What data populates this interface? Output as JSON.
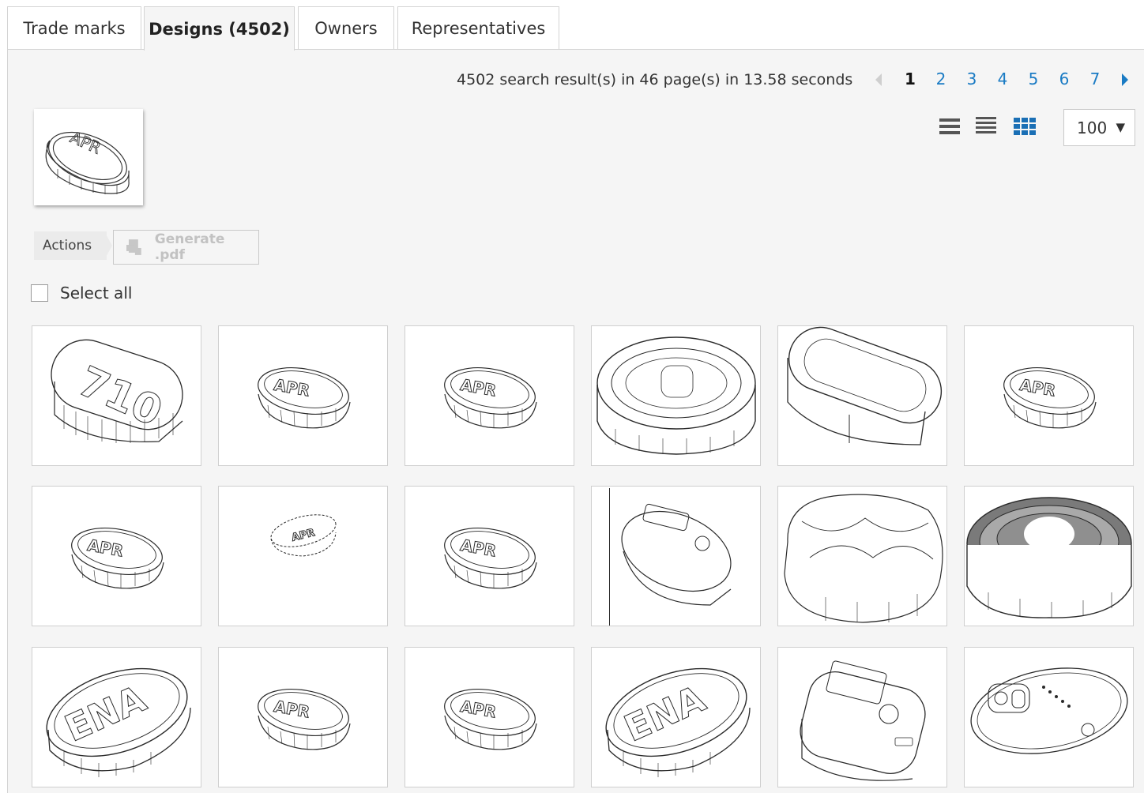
{
  "tabs": [
    {
      "label": "Trade marks",
      "active": false
    },
    {
      "label": "Designs (4502)",
      "active": true
    },
    {
      "label": "Owners",
      "active": false
    },
    {
      "label": "Representatives",
      "active": false
    }
  ],
  "results_summary": "4502 search result(s) in 46 page(s) in 13.58 seconds",
  "pagination": {
    "pages": [
      "1",
      "2",
      "3",
      "4",
      "5",
      "6",
      "7"
    ],
    "current": "1"
  },
  "view_modes": {
    "icons": [
      "list-view-icon",
      "compact-list-view-icon",
      "grid-view-icon"
    ],
    "active": "grid-view-icon"
  },
  "per_page": {
    "value": "100",
    "caret": "▼"
  },
  "actions": {
    "label": "Actions",
    "generate_pdf": "Generate .pdf"
  },
  "select_all_label": "Select all",
  "query_image": {
    "text": "APR"
  },
  "results": [
    {
      "shape": "pill",
      "text": "710"
    },
    {
      "shape": "tablet",
      "text": "APR"
    },
    {
      "shape": "tablet",
      "text": "APR"
    },
    {
      "shape": "tray",
      "text": ""
    },
    {
      "shape": "capsule",
      "text": ""
    },
    {
      "shape": "tablet",
      "text": "APR"
    },
    {
      "shape": "tablet",
      "text": "APR"
    },
    {
      "shape": "tablet-small",
      "text": "APR"
    },
    {
      "shape": "tablet",
      "text": "APR"
    },
    {
      "shape": "device",
      "text": ""
    },
    {
      "shape": "cushion",
      "text": ""
    },
    {
      "shape": "tray-shaded",
      "text": ""
    },
    {
      "shape": "oval",
      "text": "ENA"
    },
    {
      "shape": "tablet",
      "text": "APR"
    },
    {
      "shape": "tablet",
      "text": "APR"
    },
    {
      "shape": "oval",
      "text": "ENA"
    },
    {
      "shape": "device-top",
      "text": ""
    },
    {
      "shape": "device-flat",
      "text": ""
    }
  ],
  "colors": {
    "link": "#1a7bc4",
    "panel": "#f5f5f5",
    "border": "#d4d4d4"
  }
}
